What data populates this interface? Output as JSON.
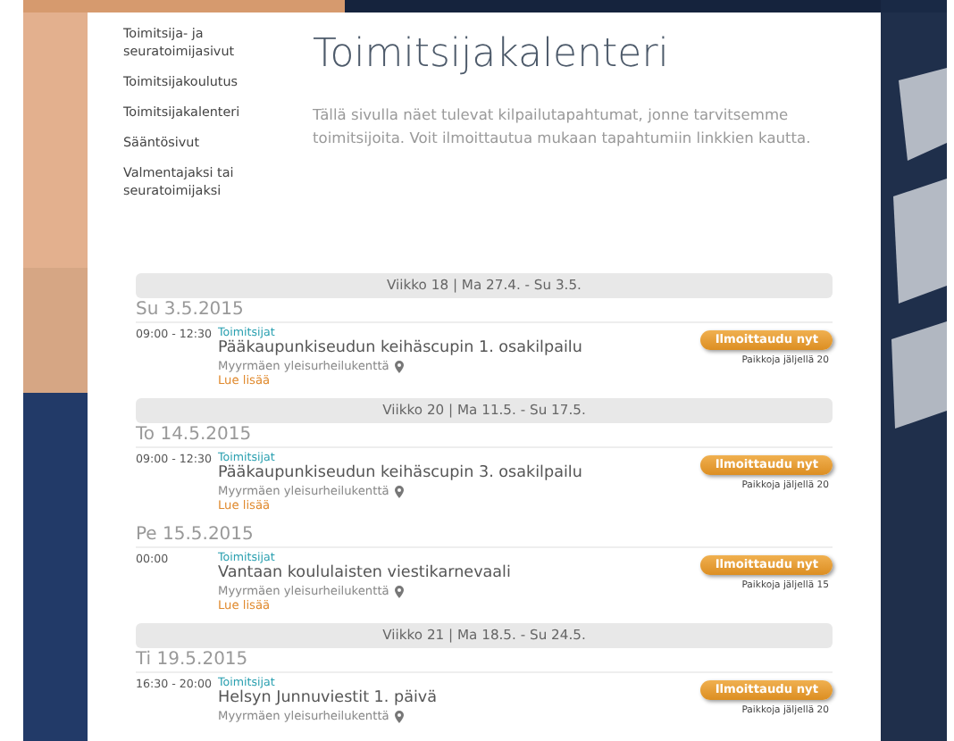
{
  "sidebar": {
    "items": [
      {
        "label": "Toimitsija- ja seuratoimijasivut"
      },
      {
        "label": "Toimitsijakoulutus"
      },
      {
        "label": "Toimitsijakalenteri"
      },
      {
        "label": "Sääntösivut"
      },
      {
        "label": "Valmentajaksi tai seuratoimijaksi"
      }
    ]
  },
  "title": "Toimitsijakalenteri",
  "intro": "Tällä sivulla näet tulevat kilpailutapahtumat, jonne tarvitsemme toimitsijoita. Voit ilmoittautua mukaan tapahtumiin linkkien kautta.",
  "weeks": [
    {
      "header": "Viikko 18 | Ma 27.4. - Su 3.5.",
      "days": [
        {
          "date": "Su 3.5.2015",
          "events": [
            {
              "time": "09:00 - 12:30",
              "category": "Toimitsijat",
              "title": "Pääkaupunkiseudun keihäscupin 1. osakilpailu",
              "location": "Myyrmäen yleisurheilukenttä",
              "read_more": "Lue lisää",
              "button": "Ilmoittaudu nyt",
              "spots": "Paikkoja jäljellä 20"
            }
          ]
        }
      ]
    },
    {
      "header": "Viikko 20 | Ma 11.5. - Su 17.5.",
      "days": [
        {
          "date": "To 14.5.2015",
          "events": [
            {
              "time": "09:00 - 12:30",
              "category": "Toimitsijat",
              "title": "Pääkaupunkiseudun keihäscupin 3. osakilpailu",
              "location": "Myyrmäen yleisurheilukenttä",
              "read_more": "Lue lisää",
              "button": "Ilmoittaudu nyt",
              "spots": "Paikkoja jäljellä 20"
            }
          ]
        },
        {
          "date": "Pe 15.5.2015",
          "events": [
            {
              "time": "00:00",
              "category": "Toimitsijat",
              "title": "Vantaan koululaisten viestikarnevaali",
              "location": "Myyrmäen yleisurheilukenttä",
              "read_more": "Lue lisää",
              "button": "Ilmoittaudu nyt",
              "spots": "Paikkoja jäljellä 15"
            }
          ]
        }
      ]
    },
    {
      "header": "Viikko 21 | Ma 18.5. - Su 24.5.",
      "days": [
        {
          "date": "Ti 19.5.2015",
          "events": [
            {
              "time": "16:30 - 20:00",
              "category": "Toimitsijat",
              "title": "Helsyn Junnuviestit 1. päivä",
              "location": "Myyrmäen yleisurheilukenttä",
              "button": "Ilmoittaudu nyt",
              "spots": "Paikkoja jäljellä 20"
            }
          ]
        }
      ]
    }
  ]
}
